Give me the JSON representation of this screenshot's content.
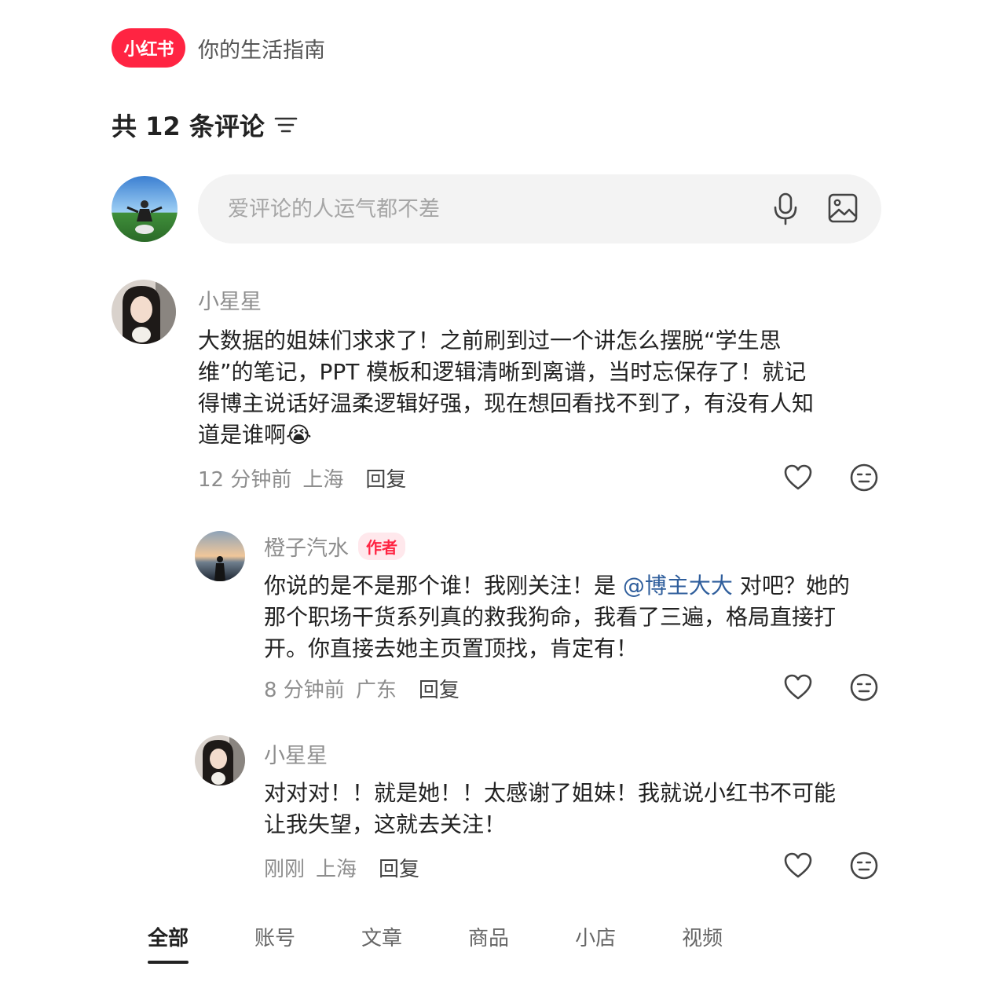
{
  "header": {
    "logo_text": "小红书",
    "slogan": "你的生活指南",
    "brand_color": "#ff2442"
  },
  "comments_header": {
    "count_label": "共 12 条评论"
  },
  "composer": {
    "placeholder": "爱评论的人运气都不差"
  },
  "comments": [
    {
      "name": "小星星",
      "text": "大数据的姐妹们求求了！之前刷到过一个讲怎么摆脱“学生思维”的笔记，PPT 模板和逻辑清晰到离谱，当时忘保存了！就记得博主说话好温柔逻辑好强，现在想回看找不到了，有没有人知道是谁啊😭",
      "time": "12 分钟前",
      "location": "上海",
      "reply_label": "回复"
    },
    {
      "name": "橙子汽水",
      "badge": "作者",
      "text_before": "你说的是不是那个谁！我刚关注！是 ",
      "mention": "@博主大大",
      "text_after": " 对吧？她的那个职场干货系列真的救我狗命，我看了三遍，格局直接打开。你直接去她主页置顶找，肯定有！",
      "time": "8 分钟前",
      "location": "广东",
      "reply_label": "回复"
    },
    {
      "name": "小星星",
      "text": "对对对！！就是她！！太感谢了姐妹！我就说小红书不可能让我失望，这就去关注！",
      "time": "刚刚",
      "location": "上海",
      "reply_label": "回复"
    }
  ],
  "tabs": [
    "全部",
    "账号",
    "文章",
    "商品",
    "小店",
    "视频"
  ],
  "active_tab": "全部"
}
